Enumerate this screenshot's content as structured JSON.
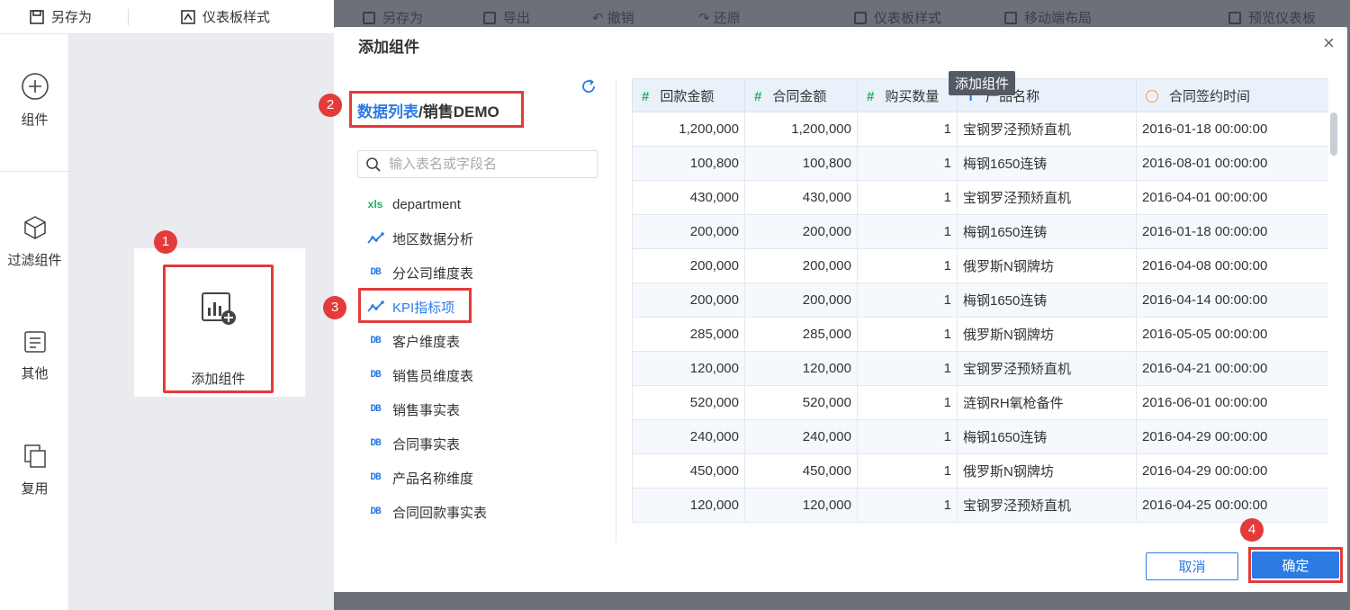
{
  "toolbar": {
    "save_as": "另存为",
    "dashboard_style": "仪表板样式"
  },
  "background_toolbar": [
    "另存为",
    "导出",
    "撤销",
    "还原",
    "仪表板样式",
    "移动端布局",
    "预览仪表板"
  ],
  "sidebar": {
    "items": [
      {
        "label": "组件",
        "icon": "plus-circle-icon"
      },
      {
        "label": "过滤组件",
        "icon": "cube-icon"
      },
      {
        "label": "其他",
        "icon": "document-icon"
      },
      {
        "label": "复用",
        "icon": "copy-icon"
      }
    ]
  },
  "canvas": {
    "add_widget_label": "添加组件"
  },
  "modal": {
    "title": "添加组件",
    "tooltip": "添加组件",
    "breadcrumb": {
      "link": "数据列表",
      "separator": "/",
      "current": "销售DEMO"
    },
    "search_placeholder": "输入表名或字段名",
    "tree": [
      {
        "label": "department",
        "type": "xls"
      },
      {
        "label": "地区数据分析",
        "type": "analysis"
      },
      {
        "label": "分公司维度表",
        "type": "db"
      },
      {
        "label": "KPI指标项",
        "type": "analysis",
        "selected": true
      },
      {
        "label": "客户维度表",
        "type": "db"
      },
      {
        "label": "销售员维度表",
        "type": "db"
      },
      {
        "label": "销售事实表",
        "type": "db"
      },
      {
        "label": "合同事实表",
        "type": "db"
      },
      {
        "label": "产品名称维度",
        "type": "db"
      },
      {
        "label": "合同回款事实表",
        "type": "db"
      }
    ],
    "columns": [
      {
        "icon": "#",
        "label": "回款金额"
      },
      {
        "icon": "#",
        "label": "合同金额"
      },
      {
        "icon": "#",
        "label": "购买数量"
      },
      {
        "icon": "T",
        "label": "产品名称"
      },
      {
        "icon": "clock",
        "label": "合同签约时间"
      }
    ],
    "rows": [
      [
        "1,200,000",
        "1,200,000",
        "1",
        "宝钢罗泾预矫直机",
        "2016-01-18 00:00:00"
      ],
      [
        "100,800",
        "100,800",
        "1",
        "梅钢1650连铸",
        "2016-08-01 00:00:00"
      ],
      [
        "430,000",
        "430,000",
        "1",
        "宝钢罗泾预矫直机",
        "2016-04-01 00:00:00"
      ],
      [
        "200,000",
        "200,000",
        "1",
        "梅钢1650连铸",
        "2016-01-18 00:00:00"
      ],
      [
        "200,000",
        "200,000",
        "1",
        "俄罗斯N钢牌坊",
        "2016-04-08 00:00:00"
      ],
      [
        "200,000",
        "200,000",
        "1",
        "梅钢1650连铸",
        "2016-04-14 00:00:00"
      ],
      [
        "285,000",
        "285,000",
        "1",
        "俄罗斯N钢牌坊",
        "2016-05-05 00:00:00"
      ],
      [
        "120,000",
        "120,000",
        "1",
        "宝钢罗泾预矫直机",
        "2016-04-21 00:00:00"
      ],
      [
        "520,000",
        "520,000",
        "1",
        "涟钢RH氧枪备件",
        "2016-06-01 00:00:00"
      ],
      [
        "240,000",
        "240,000",
        "1",
        "梅钢1650连铸",
        "2016-04-29 00:00:00"
      ],
      [
        "450,000",
        "450,000",
        "1",
        "俄罗斯N钢牌坊",
        "2016-04-29 00:00:00"
      ],
      [
        "120,000",
        "120,000",
        "1",
        "宝钢罗泾预矫直机",
        "2016-04-25 00:00:00"
      ]
    ],
    "cancel_label": "取消",
    "ok_label": "确定"
  },
  "annotations": [
    "1",
    "2",
    "3",
    "4"
  ],
  "colors": {
    "accent": "#2c7be5",
    "highlight": "#e33b3b",
    "number_icon": "#27ae60",
    "time_icon": "#f0a23c"
  }
}
